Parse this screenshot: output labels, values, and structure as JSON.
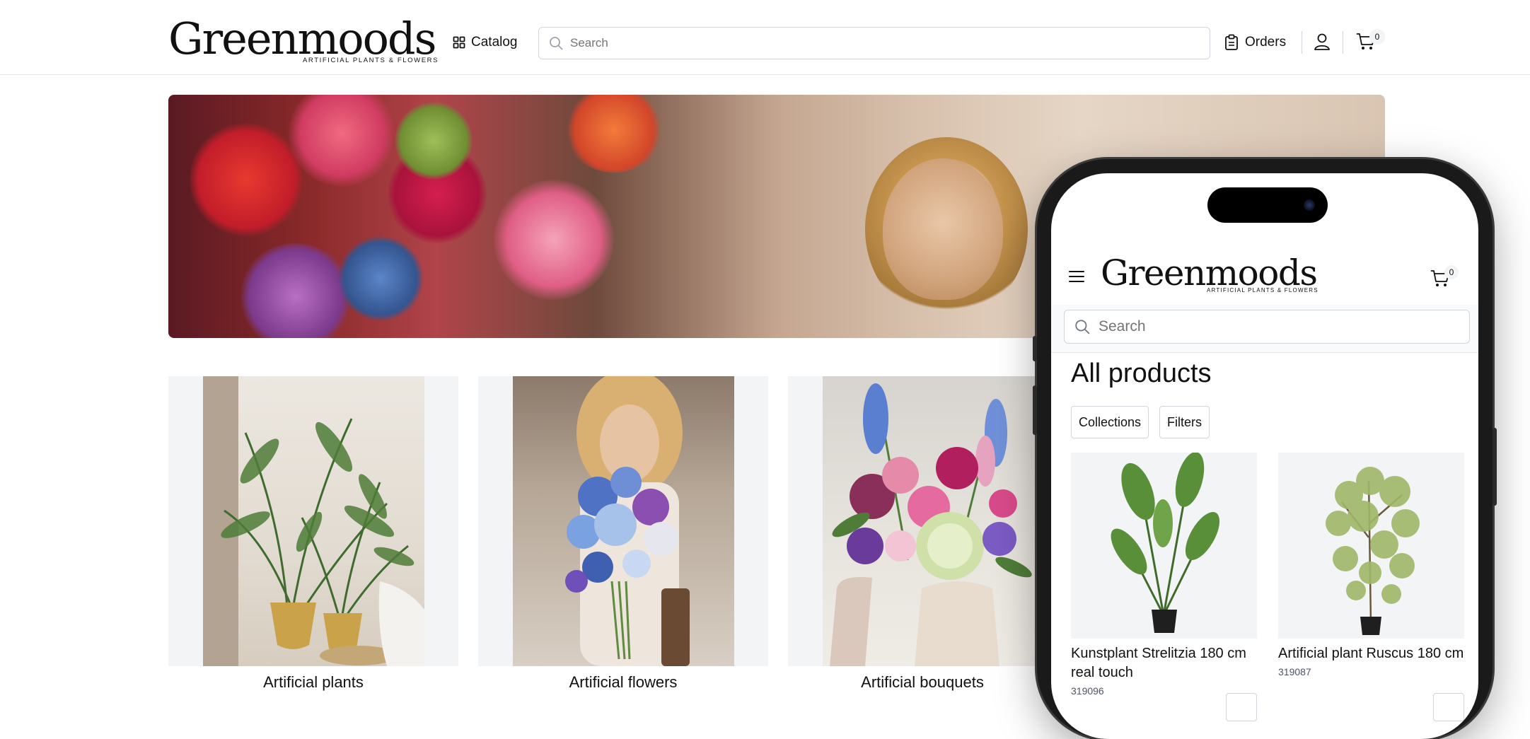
{
  "header": {
    "logo": {
      "wordmark": "Greenmoods",
      "tagline": "ARTIFICIAL PLANTS & FLOWERS"
    },
    "catalog_label": "Catalog",
    "search_placeholder": "Search",
    "orders_label": "Orders",
    "cart_count": "0"
  },
  "categories": [
    {
      "label": "Artificial plants"
    },
    {
      "label": "Artificial flowers"
    },
    {
      "label": "Artificial bouquets"
    }
  ],
  "mobile": {
    "logo": {
      "wordmark": "Greenmoods",
      "tagline": "ARTIFICIAL PLANTS & FLOWERS"
    },
    "cart_count": "0",
    "search_placeholder": "Search",
    "title": "All products",
    "collections_label": "Collections",
    "filters_label": "Filters",
    "products": [
      {
        "name": "Kunstplant Strelitzia 180 cm real touch",
        "sku": "319096"
      },
      {
        "name": "Artificial plant Ruscus 180 cm",
        "sku": "319087"
      }
    ]
  },
  "colors": {
    "border": "#d1d5db",
    "card_bg": "#f3f4f6",
    "text": "#111111"
  },
  "icons": [
    "grid-icon",
    "search-icon",
    "clipboard-icon",
    "user-icon",
    "cart-icon",
    "hamburger-icon"
  ]
}
